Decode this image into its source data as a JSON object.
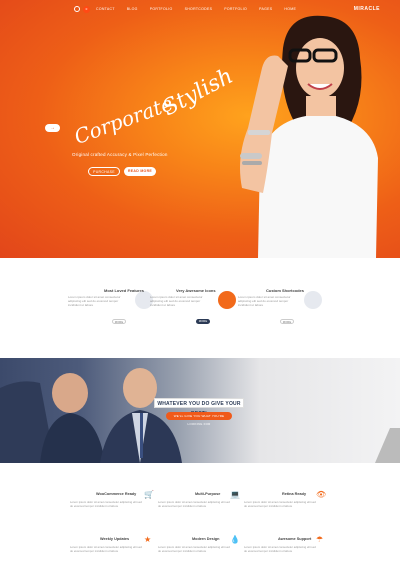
{
  "nav": {
    "logo": "MIRACLE",
    "menu": [
      "HOME",
      "PAGES",
      "PORTFOLIO",
      "BLOG",
      "SHORTCODES",
      "PORTFOLIO",
      "BLOG",
      "CONTACT"
    ],
    "cart_count": "0"
  },
  "hero": {
    "script_text": "Stylish",
    "script_text_2": "Corporate",
    "tagline": "Original crafted Accuracy & Pixel Perfection",
    "btn_read_more": "READ MORE",
    "btn_purchase": "PURCHASE",
    "arrow_label": "→"
  },
  "features": [
    {
      "title": "Most Loved Features",
      "text": "Lorem ipsum dolor sit amet consectetur adipiscing elit sed do eiusmod tempor incididunt ut labore",
      "btn": "MORE"
    },
    {
      "title": "Very Awesome Icons",
      "text": "Lorem ipsum dolor sit amet consectetur adipiscing elit sed do eiusmod tempor incididunt ut labore",
      "btn": "MORE"
    },
    {
      "title": "Custom Shortcodes",
      "text": "Lorem ipsum dolor sit amet consectetur adipiscing elit sed do eiusmod tempor incididunt ut labore",
      "btn": "MORE"
    }
  ],
  "banner": {
    "title": "WHATEVER YOU DO GIVE YOUR BEST!",
    "button": "WE'LL GIVE YOU WHAT YOU'RE LOOKING FOR"
  },
  "services": [
    {
      "title": "WooCommerce Ready",
      "icon": "cart-icon",
      "text": "Lorem ipsum dolor sit amet consectetur adipiscing elit sed do eiusmod tempor incididunt ut labore"
    },
    {
      "title": "Multi-Purpose",
      "icon": "laptop-icon",
      "text": "Lorem ipsum dolor sit amet consectetur adipiscing elit sed do eiusmod tempor incididunt ut labore"
    },
    {
      "title": "Retina Ready",
      "icon": "eye-icon",
      "text": "Lorem ipsum dolor sit amet consectetur adipiscing elit sed do eiusmod tempor incididunt ut labore"
    },
    {
      "title": "Weekly Updates",
      "icon": "star-icon",
      "text": "Lorem ipsum dolor sit amet consectetur adipiscing elit sed do eiusmod tempor incididunt ut labore"
    },
    {
      "title": "Modern Design",
      "icon": "drop-icon",
      "text": "Lorem ipsum dolor sit amet consectetur adipiscing elit sed do eiusmod tempor incididunt ut labore"
    },
    {
      "title": "Awesome Support",
      "icon": "umbrella-icon",
      "text": "Lorem ipsum dolor sit amet consectetur adipiscing elit sed do eiusmod tempor incididunt ut labore"
    }
  ],
  "colors": {
    "accent": "#f05a1a",
    "navy": "#2b3a55",
    "hero_center": "#ffa21d",
    "hero_edge": "#e2461a"
  }
}
